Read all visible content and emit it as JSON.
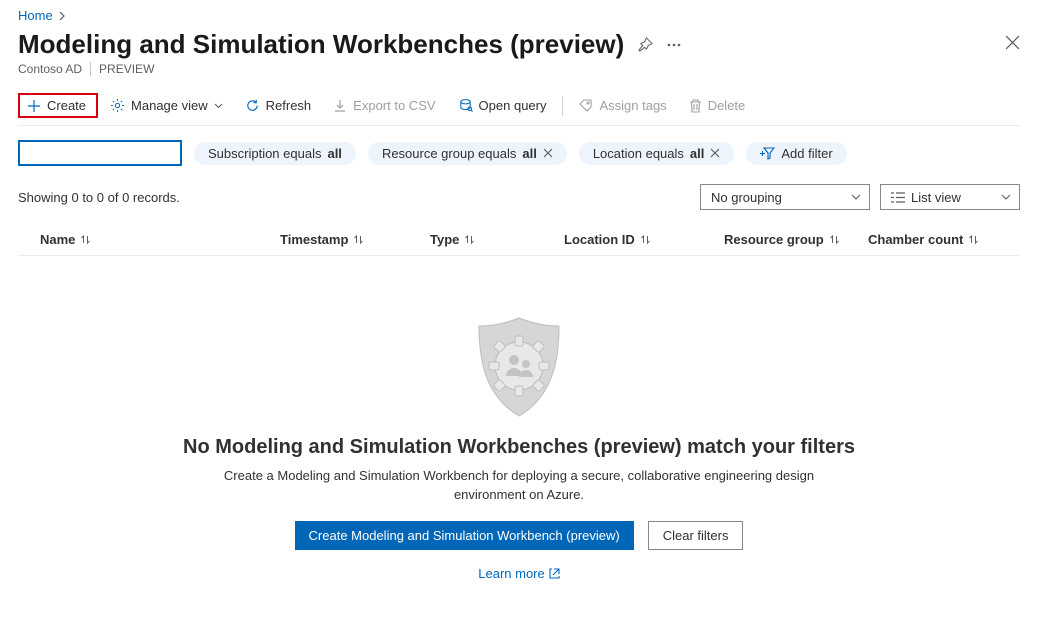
{
  "breadcrumb": {
    "home": "Home"
  },
  "header": {
    "title": "Modeling and Simulation Workbenches (preview)",
    "tenant": "Contoso AD",
    "preview_badge": "PREVIEW"
  },
  "commands": {
    "create": "Create",
    "manage_view": "Manage view",
    "refresh": "Refresh",
    "export_csv": "Export to CSV",
    "open_query": "Open query",
    "assign_tags": "Assign tags",
    "delete": "Delete"
  },
  "filters": {
    "pills": [
      {
        "label_prefix": "Subscription equals ",
        "value": "all",
        "closable": false
      },
      {
        "label_prefix": "Resource group equals ",
        "value": "all",
        "closable": true
      },
      {
        "label_prefix": "Location equals ",
        "value": "all",
        "closable": true
      }
    ],
    "add_filter": "Add filter"
  },
  "records_summary": "Showing 0 to 0 of 0 records.",
  "controls": {
    "grouping": "No grouping",
    "view_mode": "List view"
  },
  "columns": {
    "name": "Name",
    "timestamp": "Timestamp",
    "type": "Type",
    "location_id": "Location ID",
    "resource_group": "Resource group",
    "chamber_count": "Chamber count"
  },
  "empty": {
    "title": "No Modeling and Simulation Workbenches (preview) match your filters",
    "description": "Create a Modeling and Simulation Workbench for deploying a secure, collaborative engineering design environment on Azure.",
    "primary_button": "Create Modeling and Simulation Workbench (preview)",
    "secondary_button": "Clear filters",
    "learn_more": "Learn more"
  }
}
